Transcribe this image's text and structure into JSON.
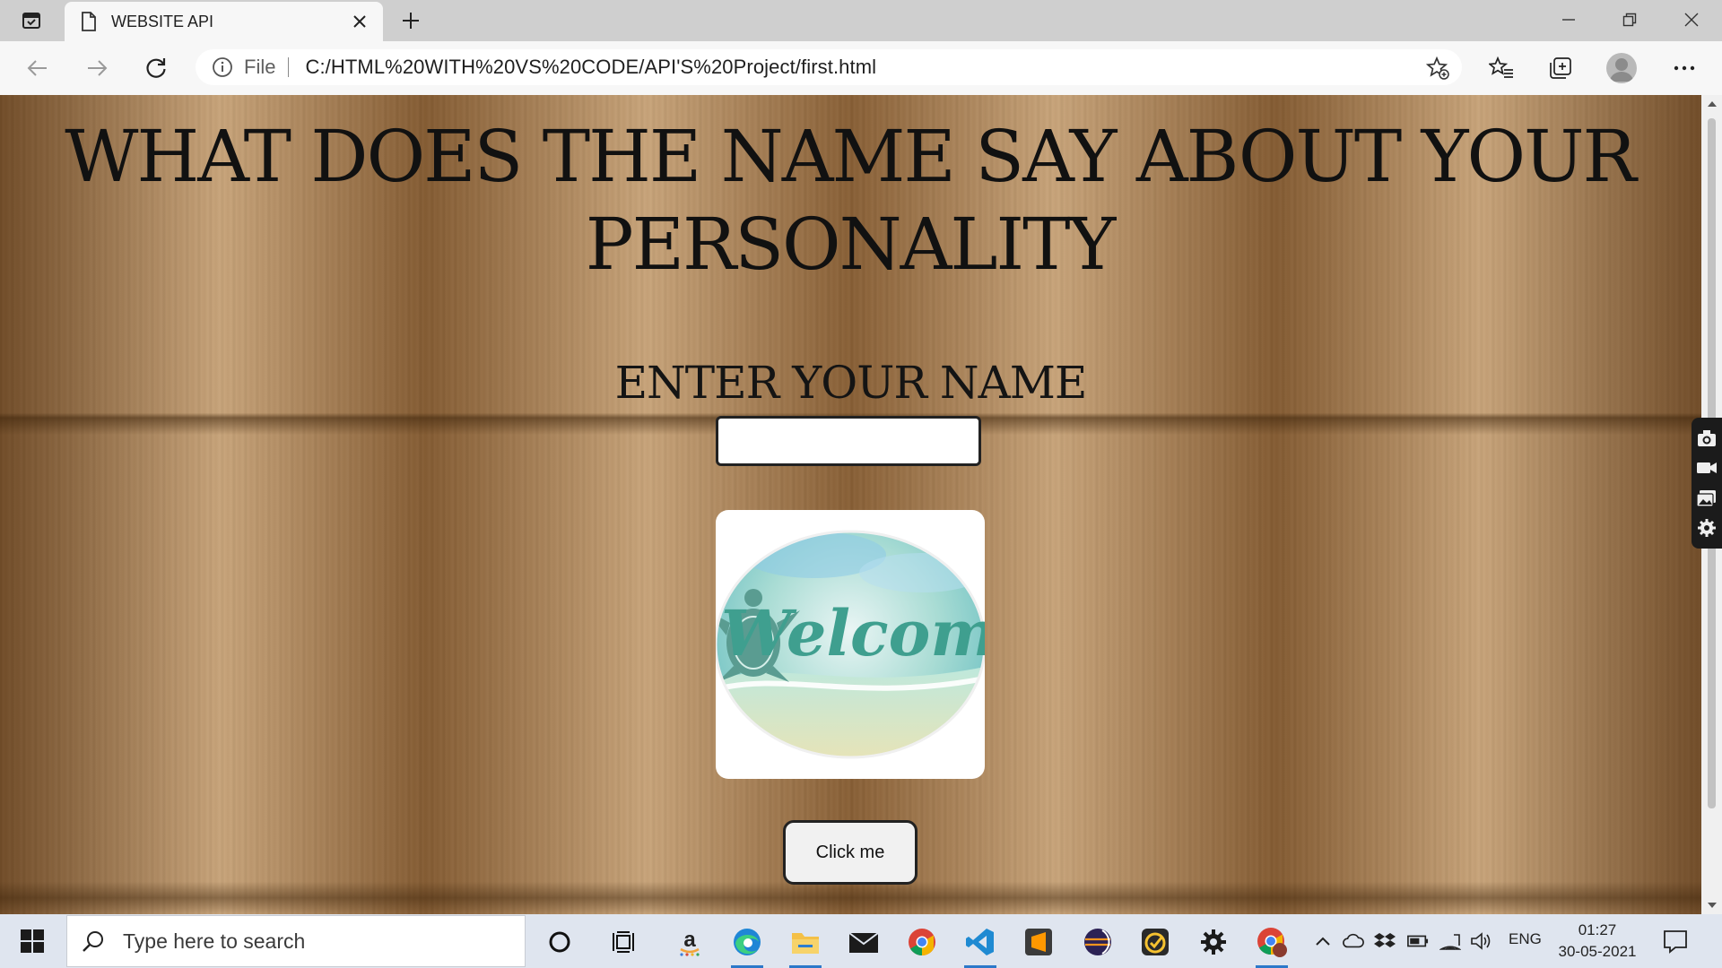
{
  "browser": {
    "tab_title": "WEBSITE API",
    "address": {
      "scheme": "File",
      "url": "C:/HTML%20WITH%20VS%20CODE/API'S%20Project/first.html"
    },
    "colors": {
      "tabstrip": "#cfcfcf",
      "toolbar": "#f7f7f7",
      "taskbar": "#dfe5ef",
      "accent": "#2c78c9"
    }
  },
  "page": {
    "heading": "WHAT DOES THE NAME SAY ABOUT YOUR PERSONALITY",
    "enter_label": "ENTER YOUR NAME",
    "name_input_value": "",
    "welcome_image_text": "Welcome",
    "button_label": "Click me",
    "background": "wood-texture"
  },
  "taskbar": {
    "search_placeholder": "Type here to search",
    "apps": [
      "cortana-icon",
      "task-view-icon",
      "amazon-icon",
      "edge-icon",
      "file-explorer-icon",
      "mail-icon",
      "chrome-icon",
      "vscode-icon",
      "sublime-icon",
      "eclipse-icon",
      "todo-icon",
      "settings-icon",
      "chrome-profile-icon"
    ],
    "language": "ENG",
    "time": "01:27",
    "date": "30-05-2021"
  }
}
